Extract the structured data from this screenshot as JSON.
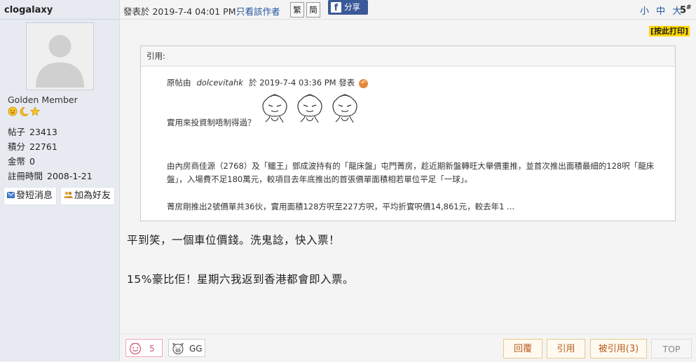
{
  "author": {
    "username": "clogalaxy",
    "rank": "Golden Member",
    "stats": [
      {
        "label": "帖子",
        "value": "23413"
      },
      {
        "label": "積分",
        "value": "22761"
      },
      {
        "label": "金幣",
        "value": "0"
      },
      {
        "label": "註冊時間",
        "value": "2008-1-21"
      }
    ],
    "send_message_label": "發短消息",
    "add_friend_label": "加為好友"
  },
  "post_header": {
    "posted_at": "發表於 2019-7-4 04:01 PM",
    "only_author_label": "只看該作者",
    "traditional_label": "繁",
    "simplified_label": "簡",
    "share_label": "分享",
    "font_sizes": "小 中 大",
    "floor_number": "5",
    "floor_mark": "#",
    "print_label": "[按此打印]"
  },
  "quote": {
    "header": "引用:",
    "prefix": "原帖由",
    "author": "dolcevitahk",
    "posted_at": "於  2019-7-4  03:36  PM  發表",
    "line1": "實用來投資制唔制得過？",
    "paragraph": "由內房商佳源（2768）及「鱷王」鄧成波持有的「龍床盤」屯門菁房，趁近期新盤轉旺大舉價重推，並首次推出面積最細的128呎「龍床盤」，入場費不足180萬元，較項目去年底推出的首張價單面積相若單位平足「一球」。",
    "last_line": "菁房剛推出2號價單共36伙，實用面積128方呎至227方呎，平均折實呎價14,861元，較去年1  ..."
  },
  "body": {
    "line1": "平到笑，一個車位價錢。洗鬼諗，快入票！",
    "line2": "15%豪比佢！星期六我返到香港都會即入票。"
  },
  "footer": {
    "like_count": "5",
    "gg_label": "GG",
    "reply_label": "回覆",
    "quote_label": "引用",
    "quoted_by_label": "被引用(3)",
    "top_label": "TOP"
  }
}
